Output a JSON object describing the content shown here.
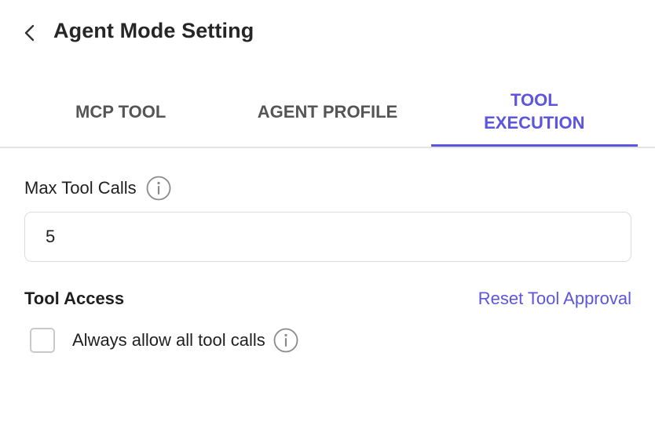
{
  "header": {
    "back_icon": "chevron-left-icon",
    "title": "Agent Mode Setting"
  },
  "tabs": [
    {
      "label": "MCP TOOL",
      "active": false
    },
    {
      "label": "AGENT PROFILE",
      "active": false
    },
    {
      "label": "TOOL EXECUTION",
      "active": true
    }
  ],
  "max_tool_calls": {
    "label": "Max Tool Calls",
    "info_icon": "info-icon",
    "value": "5"
  },
  "tool_access": {
    "title": "Tool Access",
    "reset_label": "Reset Tool Approval",
    "always_allow": {
      "label": "Always allow all tool calls",
      "checked": false,
      "info_icon": "info-icon"
    }
  },
  "colors": {
    "accent": "#5b55e0",
    "text": "#1f1f1f",
    "tab_inactive": "#555555",
    "border": "#dcdcdc",
    "divider": "#e3e3e3"
  }
}
